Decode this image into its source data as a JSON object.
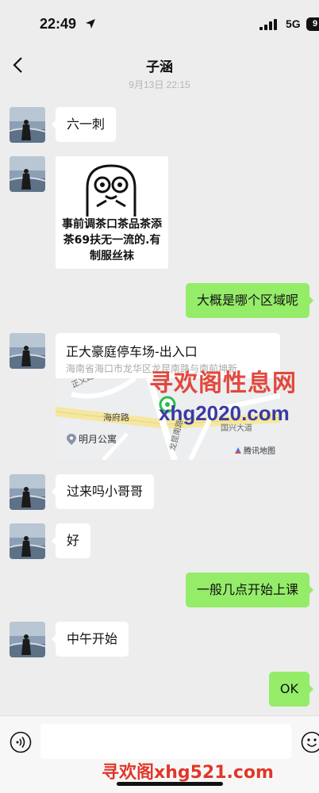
{
  "status_bar": {
    "time": "22:49",
    "network": "5G",
    "battery": "9"
  },
  "header": {
    "title": "子涵",
    "timestamp": "9月13日 22:15"
  },
  "messages": [
    {
      "text": "六一刺"
    },
    {
      "sticker_text": "事前调茶口茶品茶添茶69扶无一流的.有制服丝袜"
    },
    {
      "text": "大概是哪个区域呢"
    },
    {
      "location": {
        "title": "正大豪庭停车场-出入口",
        "address": "海南省海口市龙华区龙昆南路与南前坤新",
        "streets": [
          "正义路",
          "海府路",
          "龙昆南路",
          "国兴大道"
        ],
        "poi": "明月公寓",
        "provider": "腾讯地图"
      }
    },
    {
      "text": "过来吗小哥哥"
    },
    {
      "text": "好"
    },
    {
      "text": "一般几点开始上课"
    },
    {
      "text": "中午开始"
    },
    {
      "text": "OK"
    }
  ],
  "watermarks": {
    "top": "寻欢阁性息网",
    "url": "xhg2020.com",
    "bottom": "寻欢阁xhg521.com"
  },
  "input": {
    "placeholder": ""
  },
  "colors": {
    "outgoing_bubble": "#95ec69",
    "incoming_bubble": "#ffffff",
    "background": "#ededed",
    "watermark_red": "#e0372a"
  },
  "icons": [
    "location-arrow-icon",
    "signal-icon",
    "battery-icon",
    "back-icon",
    "map-pin-icon",
    "voice-icon",
    "emoji-icon"
  ]
}
